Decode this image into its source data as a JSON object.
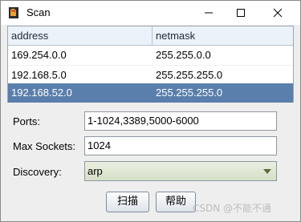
{
  "window": {
    "title": "Scan",
    "controls": {
      "minimize": "minimize",
      "maximize": "maximize",
      "close": "close"
    }
  },
  "table": {
    "columns": [
      "address",
      "netmask"
    ],
    "rows": [
      {
        "address": "169.254.0.0",
        "netmask": "255.255.0.0"
      },
      {
        "address": "192.168.5.0",
        "netmask": "255.255.255.0"
      },
      {
        "address": "192.168.52.0",
        "netmask": "255.255.255.0"
      }
    ],
    "selected_row": 2
  },
  "form": {
    "ports_label": "Ports:",
    "ports_value": "1-1024,3389,5000-6000",
    "sockets_label": "Max Sockets:",
    "sockets_value": "1024",
    "discovery_label": "Discovery:",
    "discovery_value": "arp"
  },
  "buttons": {
    "scan": "扫描",
    "help": "帮助"
  },
  "watermark": "CSDN @不能不通",
  "colors": {
    "selection": "#5a7fac",
    "header": "#ebf2f9",
    "background": "#eeeeee"
  },
  "icons": {
    "app": "coffee-cup-icon",
    "dropdown": "chevron-down-icon"
  }
}
